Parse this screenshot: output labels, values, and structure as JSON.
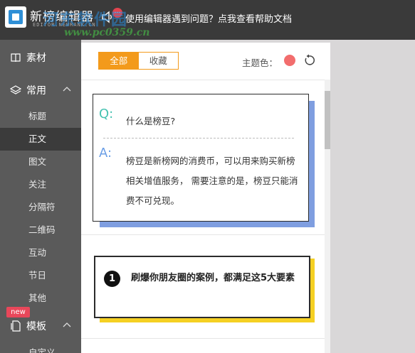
{
  "header": {
    "app_title": "新榜编辑器",
    "app_subtitle": "EDITOR.NEWRANK.CN",
    "watermark_text": "河东软件园",
    "watermark_url": "www.pc0359.cn",
    "notification_glyph": "…",
    "help_link": "使用编辑器遇到问题？点我查看帮助文档"
  },
  "sidebar": {
    "sections": [
      {
        "label": "素材",
        "icon": "book-icon"
      },
      {
        "label": "常用",
        "icon": "layers-icon"
      },
      {
        "label": "模板",
        "icon": "document-icon"
      }
    ],
    "items": [
      "标题",
      "正文",
      "图文",
      "关注",
      "分隔符",
      "二维码",
      "互动",
      "节日",
      "其他"
    ],
    "active_item": "正文",
    "new_badge": "new",
    "last_item": "自定义"
  },
  "panel": {
    "tabs": [
      "全部",
      "收藏"
    ],
    "active_tab": "全部",
    "theme_label": "主题色：",
    "theme_color": "#f26d6d"
  },
  "cards": {
    "qa": {
      "q_mark": "Q:",
      "question": "什么是榜豆?",
      "a_mark": "A:",
      "answer": "榜豆是新榜网的消费币，可以用来购买新榜相关增值服务， 需要注意的是，榜豆只能消费不可兑现。"
    },
    "numbered": {
      "number": "1",
      "text": "刷爆你朋友圈的案例，都满足这5大要素"
    }
  },
  "colors": {
    "accent_orange": "#f39a1b",
    "q_color": "#45c2b1",
    "a_color": "#6a9ee6",
    "card1_shadow": "#7f9ee0",
    "card2_shadow": "#f5d023"
  }
}
